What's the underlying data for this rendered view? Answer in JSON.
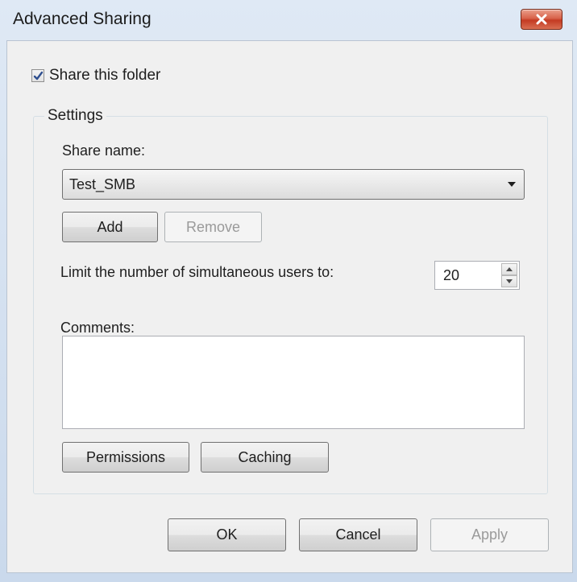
{
  "window": {
    "title": "Advanced Sharing",
    "close_icon": "close-icon"
  },
  "share_checkbox": {
    "label": "Share this folder",
    "checked": true
  },
  "settings": {
    "legend": "Settings",
    "share_name_label": "Share name:",
    "share_name_value": "Test_SMB",
    "add_label": "Add",
    "remove_label": "Remove",
    "limit_label": "Limit the number of simultaneous users to:",
    "limit_value": "20",
    "comments_label": "Comments:",
    "comments_value": "",
    "permissions_label": "Permissions",
    "caching_label": "Caching"
  },
  "footer": {
    "ok_label": "OK",
    "cancel_label": "Cancel",
    "apply_label": "Apply"
  },
  "colors": {
    "close_button": "#c9442b",
    "dialog_bg": "#f0f0f0",
    "frame": "#cad9ec"
  }
}
